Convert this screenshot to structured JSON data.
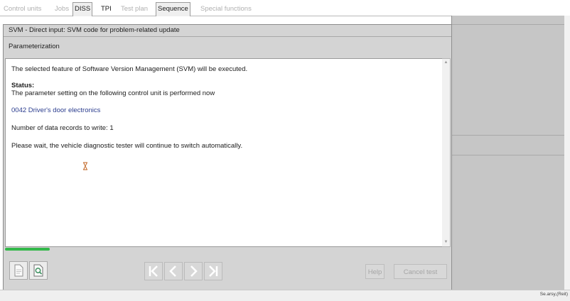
{
  "tabs": [
    {
      "label": "Control units"
    },
    {
      "label": "Jobs"
    },
    {
      "label": "DISS"
    },
    {
      "label": "TPI"
    },
    {
      "label": "Test plan"
    },
    {
      "label": "Sequence"
    },
    {
      "label": "Special functions"
    }
  ],
  "panel": {
    "title": "SVM - Direct input: SVM code for problem-related update",
    "subtitle": "Parameterization"
  },
  "content": {
    "intro": "The selected feature of Software Version Management (SVM) will be executed.",
    "status_label": "Status:",
    "status_text": "The parameter setting on the following control unit is performed now",
    "control_unit": "0042 Driver's door electronics",
    "records": "Number of data records to write: 1",
    "wait_text": "Please wait, the vehicle diagnostic tester will continue to switch automatically."
  },
  "progress": {
    "fraction": 0.1
  },
  "toolbar": {
    "help_label": "Help",
    "cancel_label": "Cancel test"
  },
  "status_bar": {
    "text": "Se.arsy,(Reit)"
  }
}
